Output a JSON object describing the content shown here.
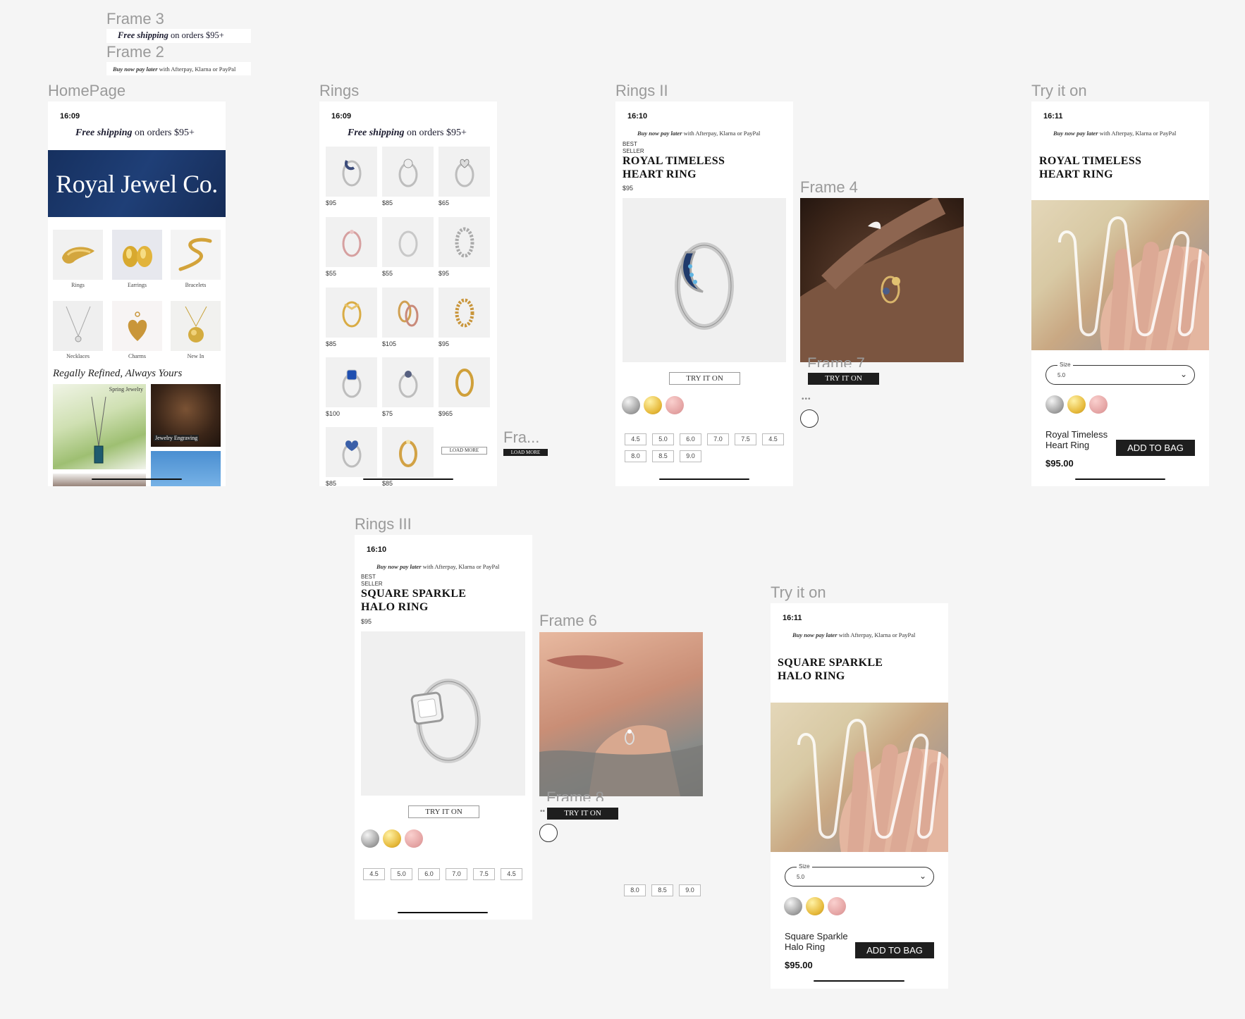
{
  "frame_labels": {
    "frame3": "Frame 3",
    "frame2": "Frame 2",
    "homepage": "HomePage",
    "rings": "Rings",
    "rings2": "Rings II",
    "frame4": "Frame 4",
    "tryon1": "Try it on",
    "fra": "Fra...",
    "rings3": "Rings III",
    "frame6": "Frame 6",
    "tryon2": "Try it on",
    "frame7": "Frame 7",
    "frame8": "Frame 8"
  },
  "banners": {
    "free_shipping_em": "Free shipping",
    "free_shipping_rest": " on orders $95+",
    "bnpl_em": "Buy now pay later",
    "bnpl_rest": " with Afterpay, Klarna or PayPal"
  },
  "times": {
    "home": "16:09",
    "rings": "16:09",
    "rings2": "16:10",
    "tryon1": "16:11",
    "rings3": "16:10",
    "tryon2": "16:11"
  },
  "homepage": {
    "brand": "Royal Jewel Co.",
    "categories": [
      "Rings",
      "Earrings",
      "Bracelets",
      "Necklaces",
      "Charms",
      "New In"
    ],
    "tagline": "Regally Refined, Always Yours",
    "promo1": "Spring Jewelry",
    "promo2": "Jewelry Engraving"
  },
  "rings_grid": {
    "prices": [
      "$95",
      "$85",
      "$65",
      "$55",
      "$55",
      "$95",
      "$85",
      "$105",
      "$95",
      "$100",
      "$75",
      "$965",
      "$85",
      "$85"
    ],
    "load_more": "LOAD MORE"
  },
  "fra_button": "LOAD MORE",
  "product1": {
    "badge_line1": "BEST",
    "badge_line2": "SELLER",
    "name_line1": "ROYAL TIMELESS",
    "name_line2": "HEART RING",
    "price": "$95",
    "try_on": "TRY IT ON",
    "sizes": [
      "4.5",
      "5.0",
      "6.0",
      "7.0",
      "7.5",
      "4.5",
      "8.0",
      "8.5",
      "9.0"
    ]
  },
  "frame7_button": "TRY IT ON",
  "tryon1": {
    "name_line1": "ROYAL TIMELESS",
    "name_line2": "HEART RING",
    "size_label": "Size",
    "size_value": "5.0",
    "summary_line1": "Royal Timeless",
    "summary_line2": "Heart Ring",
    "summary_price": "$95.00",
    "add_to_bag": "ADD TO BAG"
  },
  "product2": {
    "badge_line1": "BEST",
    "badge_line2": "SELLER",
    "name_line1": "SQUARE SPARKLE",
    "name_line2": "HALO RING",
    "price": "$95",
    "try_on": "TRY IT ON",
    "sizes": [
      "4.5",
      "5.0",
      "6.0",
      "7.0",
      "7.5",
      "4.5"
    ]
  },
  "frame8": {
    "button": "TRY IT ON",
    "sizes": [
      "8.0",
      "8.5",
      "9.0"
    ]
  },
  "tryon2": {
    "name_line1": "SQUARE SPARKLE",
    "name_line2": "HALO RING",
    "size_label": "Size",
    "size_value": "5.0",
    "summary_line1": "Square Sparkle",
    "summary_line2": "Halo Ring",
    "summary_price": "$95.00",
    "add_to_bag": "ADD TO BAG"
  },
  "colors": {
    "brand_navy": "#1c3566",
    "canvas": "#f5f5f5",
    "dark_button": "#1e1e1e"
  }
}
